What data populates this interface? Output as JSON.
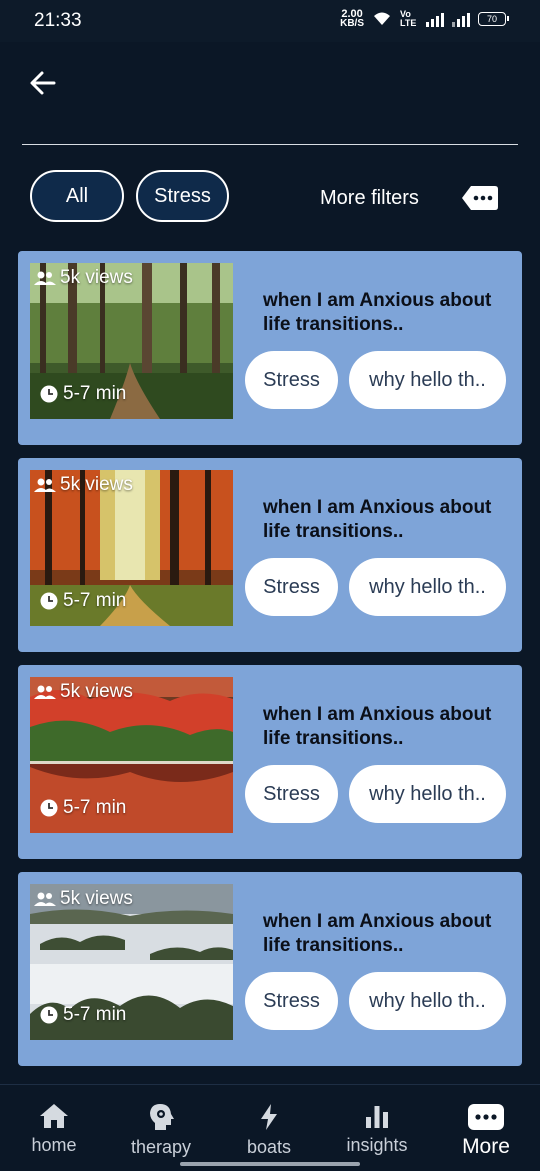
{
  "status_bar": {
    "time": "21:33",
    "speed_value": "2.00",
    "speed_unit": "KB/S",
    "network": "Vo LTE",
    "battery": "70"
  },
  "filters": {
    "chips": [
      "All",
      "Stress"
    ],
    "more_filters_label": "More filters"
  },
  "cards": [
    {
      "views": "5k views",
      "duration": "5-7 min",
      "title": "when I am Anxious about life transitions..",
      "tags": [
        "Stress",
        "why hello th.."
      ],
      "scene": "green-forest"
    },
    {
      "views": "5k views",
      "duration": "5-7 min",
      "title": "when I am Anxious about life transitions..",
      "tags": [
        "Stress",
        "why hello th.."
      ],
      "scene": "autumn-forest"
    },
    {
      "views": "5k views",
      "duration": "5-7 min",
      "title": "when I am Anxious about life transitions..",
      "tags": [
        "Stress",
        "why hello th.."
      ],
      "scene": "autumn-lake"
    },
    {
      "views": "5k views",
      "duration": "5-7 min",
      "title": "when I am Anxious about life transitions..",
      "tags": [
        "Stress",
        "why hello th.."
      ],
      "scene": "misty-forest"
    }
  ],
  "nav": {
    "items": [
      {
        "label": "home",
        "icon": "home-icon"
      },
      {
        "label": "therapy",
        "icon": "head-gear-icon"
      },
      {
        "label": "boats",
        "icon": "lightning-icon"
      },
      {
        "label": "insights",
        "icon": "bar-chart-icon"
      },
      {
        "label": "More",
        "icon": "more-icon",
        "active": true
      }
    ]
  },
  "colors": {
    "background": "#0b1726",
    "card": "#7ea4d8",
    "chip": "#0f2a4a",
    "pill": "#ffffff"
  }
}
